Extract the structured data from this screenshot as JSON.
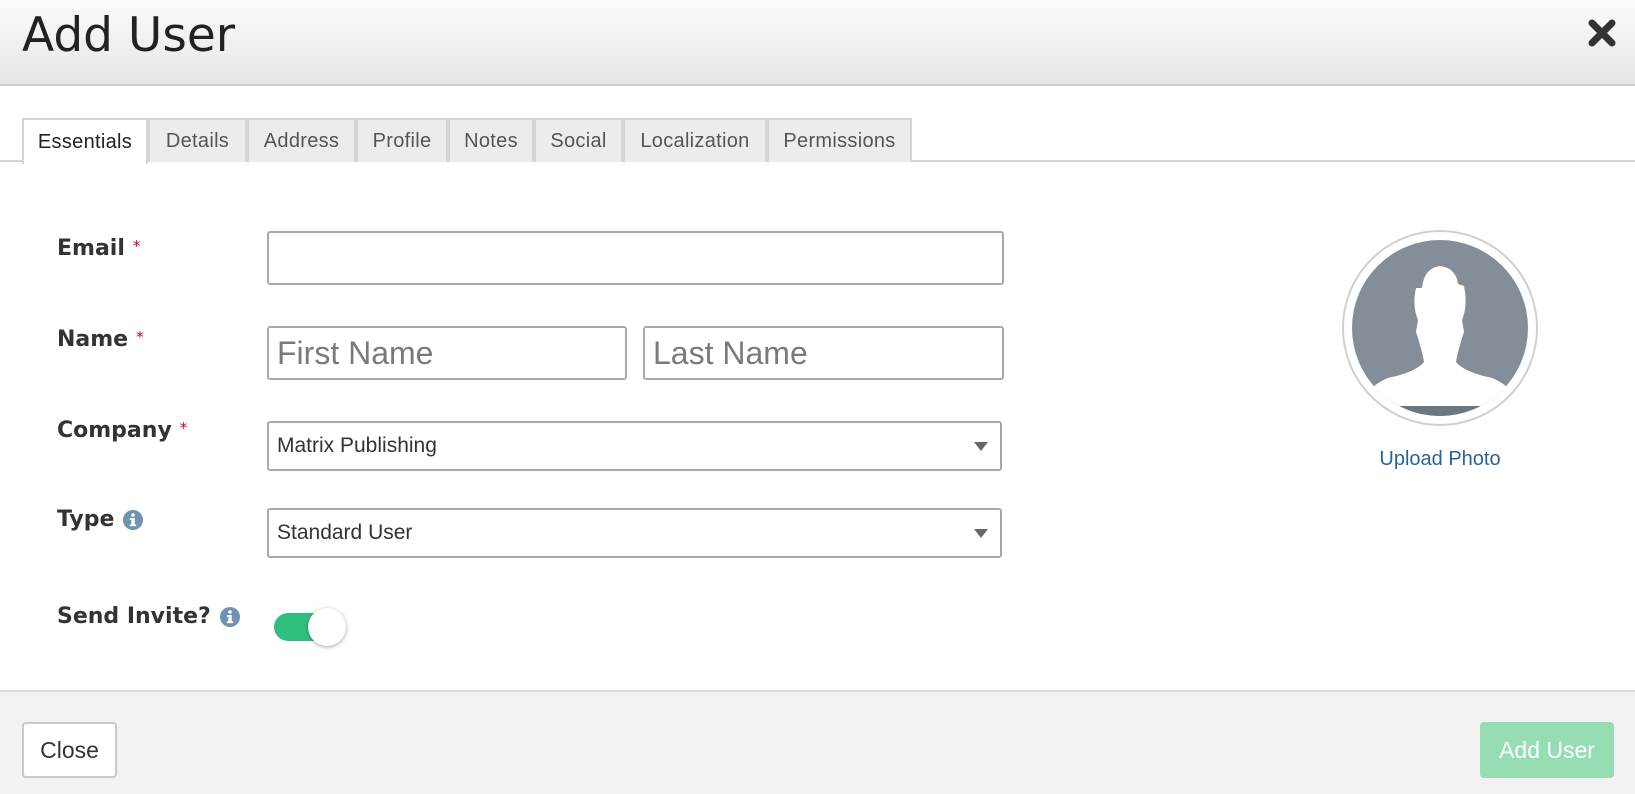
{
  "header": {
    "title": "Add User",
    "close_icon": "close-icon"
  },
  "tabs": [
    {
      "label": "Essentials",
      "active": true
    },
    {
      "label": "Details"
    },
    {
      "label": "Address"
    },
    {
      "label": "Profile"
    },
    {
      "label": "Notes"
    },
    {
      "label": "Social"
    },
    {
      "label": "Localization"
    },
    {
      "label": "Permissions"
    }
  ],
  "form": {
    "email": {
      "label": "Email",
      "required_mark": "*",
      "value": ""
    },
    "name": {
      "label": "Name",
      "required_mark": "*",
      "first_placeholder": "First Name",
      "last_placeholder": "Last Name"
    },
    "company": {
      "label": "Company",
      "required_mark": "*",
      "selected": "Matrix Publishing"
    },
    "type": {
      "label": "Type",
      "selected": "Standard User",
      "info_icon": "info-icon"
    },
    "send_invite": {
      "label": "Send Invite?",
      "enabled": true,
      "info_icon": "info-icon"
    }
  },
  "photo": {
    "upload_label": "Upload Photo",
    "placeholder_icon": "user-silhouette-icon"
  },
  "footer": {
    "close_label": "Close",
    "add_label": "Add User"
  },
  "colors": {
    "accent_green": "#2fc07f",
    "add_button_disabled": "#97ddb4",
    "link_blue": "#2a6496",
    "required_red": "#d0021b",
    "info_blue": "#6f94b0",
    "avatar_gray": "#838e99"
  }
}
